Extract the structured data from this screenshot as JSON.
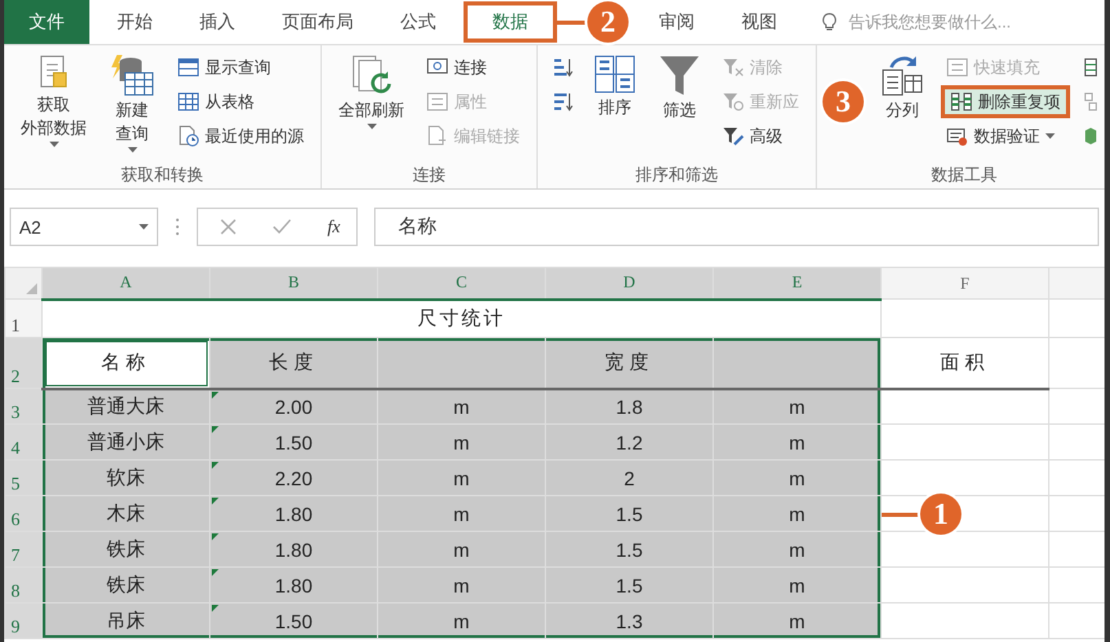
{
  "tabs": [
    {
      "label": "文件",
      "kind": "file",
      "selected": false,
      "highlighted": false
    },
    {
      "label": "开始",
      "kind": "tab",
      "selected": false,
      "highlighted": false
    },
    {
      "label": "插入",
      "kind": "tab",
      "selected": false,
      "highlighted": false
    },
    {
      "label": "页面布局",
      "kind": "tab",
      "selected": false,
      "highlighted": false
    },
    {
      "label": "公式",
      "kind": "tab",
      "selected": false,
      "highlighted": false
    },
    {
      "label": "数据",
      "kind": "tab",
      "selected": true,
      "highlighted": true,
      "callout": "2"
    },
    {
      "label": "审阅",
      "kind": "tab",
      "selected": false,
      "highlighted": false
    },
    {
      "label": "视图",
      "kind": "tab",
      "selected": false,
      "highlighted": false
    }
  ],
  "tell_me": {
    "placeholder": "告诉我您想要做什么..."
  },
  "ribbon": {
    "groups": [
      {
        "label": "获取和转换",
        "items": [
          {
            "kind": "large",
            "lines": [
              "获取",
              "外部数据"
            ],
            "dropdown": true,
            "disabled": false
          },
          {
            "kind": "large",
            "lines": [
              "新建",
              "查询"
            ],
            "dropdown": true,
            "disabled": false
          },
          {
            "kind": "stack",
            "items": [
              {
                "label": "显示查询",
                "disabled": false
              },
              {
                "label": "从表格",
                "disabled": false
              },
              {
                "label": "最近使用的源",
                "disabled": false
              }
            ]
          }
        ]
      },
      {
        "label": "连接",
        "items": [
          {
            "kind": "large",
            "lines": [
              "全部刷新"
            ],
            "dropdown": true,
            "disabled": false
          },
          {
            "kind": "stack",
            "items": [
              {
                "label": "连接",
                "disabled": false
              },
              {
                "label": "属性",
                "disabled": true
              },
              {
                "label": "编辑链接",
                "disabled": true
              }
            ]
          }
        ]
      },
      {
        "label": "排序和筛选",
        "items": [
          {
            "kind": "stack",
            "items": [
              {
                "disabled": false
              },
              {
                "disabled": false
              }
            ]
          },
          {
            "kind": "large",
            "lines": [
              "排序"
            ],
            "dropdown": false,
            "disabled": false
          },
          {
            "kind": "large",
            "lines": [
              "筛选"
            ],
            "dropdown": false,
            "disabled": false
          },
          {
            "kind": "stack",
            "items": [
              {
                "label": "清除",
                "disabled": true
              },
              {
                "label": "重新应",
                "disabled": true
              },
              {
                "label": "高级",
                "disabled": false
              }
            ]
          }
        ]
      },
      {
        "label": "数据工具",
        "callout": "3",
        "items": [
          {
            "kind": "large",
            "lines": [
              "分列"
            ],
            "dropdown": false,
            "disabled": false
          },
          {
            "kind": "stack",
            "items": [
              {
                "label": "快速填充",
                "disabled": true
              },
              {
                "label": "删除重复项",
                "disabled": false,
                "highlighted": true
              },
              {
                "label": "数据验证",
                "disabled": false,
                "dropdown": true
              }
            ]
          },
          {
            "kind": "stack",
            "items": [
              {
                "disabled": false
              },
              {
                "disabled": false
              },
              {
                "disabled": false
              }
            ]
          }
        ]
      }
    ]
  },
  "formula_bar": {
    "name_box": "A2",
    "function_label": "fx",
    "value": "名称"
  },
  "sheet": {
    "columns": [
      {
        "label": "A",
        "selected": true
      },
      {
        "label": "B",
        "selected": true
      },
      {
        "label": "C",
        "selected": true
      },
      {
        "label": "D",
        "selected": true
      },
      {
        "label": "E",
        "selected": true
      },
      {
        "label": "F",
        "selected": false
      }
    ],
    "rows": [
      {
        "label": "1",
        "selected": false,
        "title": "尺寸统计"
      },
      {
        "label": "2",
        "selected": true,
        "kind": "header",
        "cells": [
          {
            "text": "名称",
            "selected": true,
            "active": true
          },
          {
            "text": "长度",
            "selected": true
          },
          {
            "selected": true
          },
          {
            "text": "宽度",
            "selected": true
          },
          {
            "selected": true
          },
          {
            "text": "面积",
            "selected": false
          }
        ]
      },
      {
        "label": "3",
        "selected": true,
        "cells": [
          {
            "text": "普通大床",
            "selected": true
          },
          {
            "text": "2.00",
            "selected": true,
            "flag": true
          },
          {
            "text": "m",
            "selected": true
          },
          {
            "text": "1.8",
            "selected": true
          },
          {
            "text": "m",
            "selected": true
          },
          {
            "selected": false
          }
        ]
      },
      {
        "label": "4",
        "selected": true,
        "cells": [
          {
            "text": "普通小床",
            "selected": true
          },
          {
            "text": "1.50",
            "selected": true,
            "flag": true
          },
          {
            "text": "m",
            "selected": true
          },
          {
            "text": "1.2",
            "selected": true
          },
          {
            "text": "m",
            "selected": true
          },
          {
            "selected": false
          }
        ]
      },
      {
        "label": "5",
        "selected": true,
        "cells": [
          {
            "text": "软床",
            "selected": true
          },
          {
            "text": "2.20",
            "selected": true,
            "flag": true
          },
          {
            "text": "m",
            "selected": true
          },
          {
            "text": "2",
            "selected": true
          },
          {
            "text": "m",
            "selected": true
          },
          {
            "selected": false
          }
        ]
      },
      {
        "label": "6",
        "selected": true,
        "callout": "1",
        "cells": [
          {
            "text": "木床",
            "selected": true
          },
          {
            "text": "1.80",
            "selected": true,
            "flag": true
          },
          {
            "text": "m",
            "selected": true
          },
          {
            "text": "1.5",
            "selected": true
          },
          {
            "text": "m",
            "selected": true
          },
          {
            "selected": false
          }
        ]
      },
      {
        "label": "7",
        "selected": true,
        "cells": [
          {
            "text": "铁床",
            "selected": true
          },
          {
            "text": "1.80",
            "selected": true,
            "flag": true
          },
          {
            "text": "m",
            "selected": true
          },
          {
            "text": "1.5",
            "selected": true
          },
          {
            "text": "m",
            "selected": true
          },
          {
            "selected": false
          }
        ]
      },
      {
        "label": "8",
        "selected": true,
        "cells": [
          {
            "text": "铁床",
            "selected": true
          },
          {
            "text": "1.80",
            "selected": true,
            "flag": true
          },
          {
            "text": "m",
            "selected": true
          },
          {
            "text": "1.5",
            "selected": true
          },
          {
            "text": "m",
            "selected": true
          },
          {
            "selected": false
          }
        ]
      },
      {
        "label": "9",
        "selected": true,
        "cells": [
          {
            "text": "吊床",
            "selected": true
          },
          {
            "text": "1.50",
            "selected": true,
            "flag": true
          },
          {
            "text": "m",
            "selected": true
          },
          {
            "text": "1.3",
            "selected": true
          },
          {
            "text": "m",
            "selected": true
          },
          {
            "selected": false
          }
        ]
      }
    ]
  }
}
